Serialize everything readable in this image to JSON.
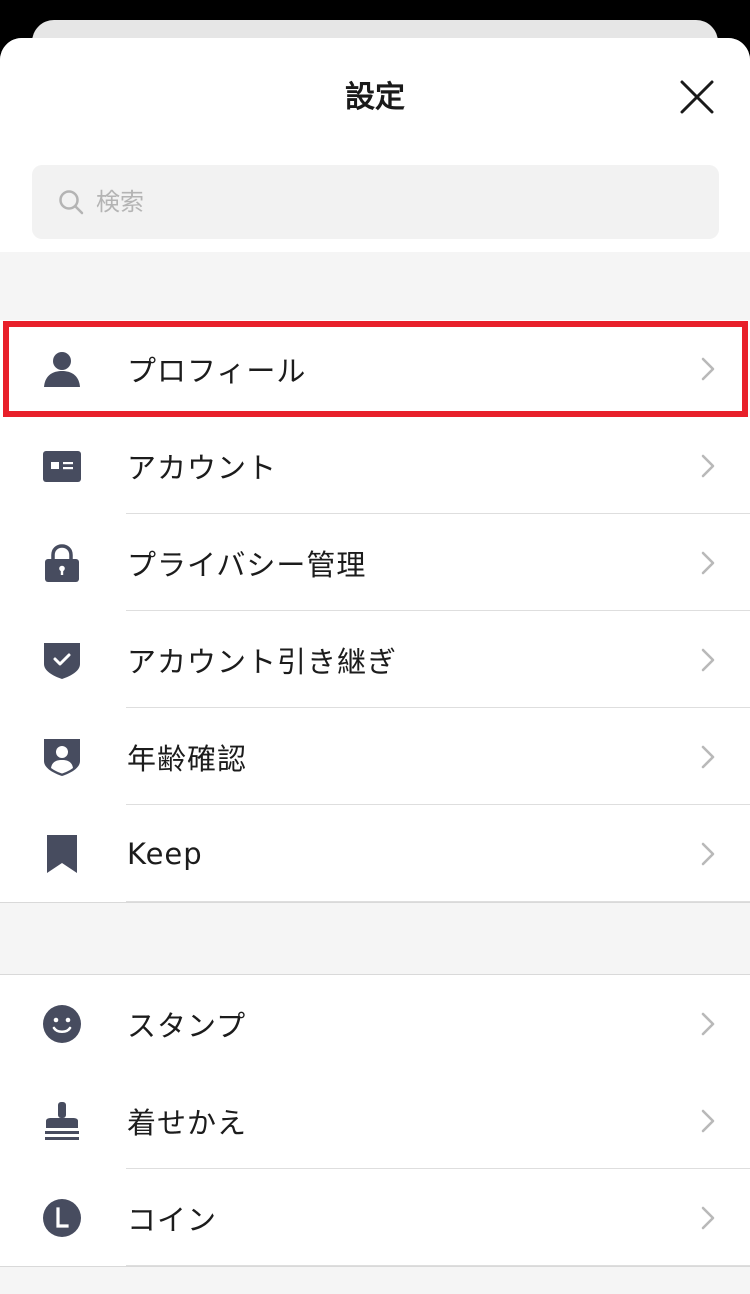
{
  "header": {
    "title": "設定"
  },
  "search": {
    "placeholder": "検索"
  },
  "groups": [
    {
      "items": [
        {
          "label": "プロフィール",
          "icon": "person-icon"
        },
        {
          "label": "アカウント",
          "icon": "id-card-icon"
        },
        {
          "label": "プライバシー管理",
          "icon": "lock-icon"
        },
        {
          "label": "アカウント引き継ぎ",
          "icon": "shield-check-icon"
        },
        {
          "label": "年齢確認",
          "icon": "shield-person-icon"
        },
        {
          "label": "Keep",
          "icon": "bookmark-icon"
        }
      ]
    },
    {
      "items": [
        {
          "label": "スタンプ",
          "icon": "smiley-icon"
        },
        {
          "label": "着せかえ",
          "icon": "stamp-brush-icon"
        },
        {
          "label": "コイン",
          "icon": "coin-icon"
        }
      ]
    }
  ],
  "colors": {
    "icon": "#474c5f",
    "highlight": "#e8202a",
    "chevron": "#b9b9b9"
  }
}
